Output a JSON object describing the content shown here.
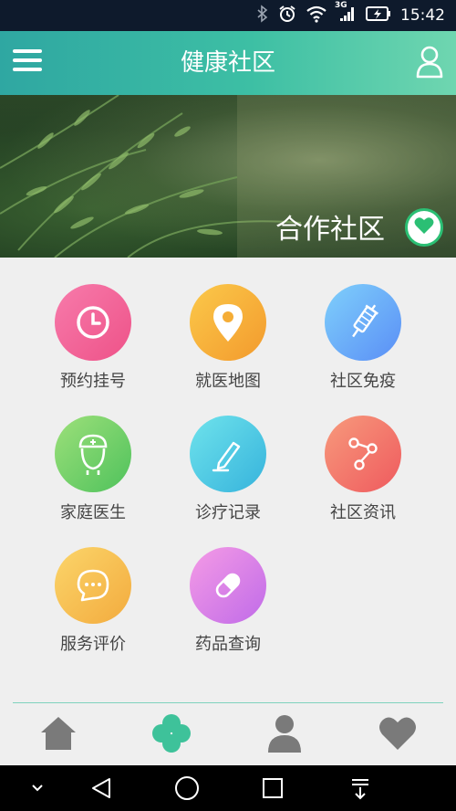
{
  "status_bar": {
    "network": "3G",
    "time": "15:42"
  },
  "header": {
    "title": "健康社区",
    "menu_icon": "menu-icon",
    "user_icon": "user-icon"
  },
  "banner": {
    "caption": "合作社区",
    "heart_icon": "heart-icon"
  },
  "services": [
    {
      "label": "预约挂号",
      "icon": "clock-icon",
      "color_from": "#f77bab",
      "color_to": "#ee5288"
    },
    {
      "label": "就医地图",
      "icon": "location-pin-icon",
      "color_from": "#fbc94a",
      "color_to": "#f39a2d"
    },
    {
      "label": "社区免疫",
      "icon": "syringe-icon",
      "color_from": "#7fd0fb",
      "color_to": "#5a8ef6"
    },
    {
      "label": "家庭医生",
      "icon": "doctor-icon",
      "color_from": "#9de07a",
      "color_to": "#4fc25c"
    },
    {
      "label": "诊疗记录",
      "icon": "pen-icon",
      "color_from": "#6fe3ec",
      "color_to": "#36b3dc"
    },
    {
      "label": "社区资讯",
      "icon": "share-nodes-icon",
      "color_from": "#f79a7c",
      "color_to": "#ef5a5e"
    },
    {
      "label": "服务评价",
      "icon": "chat-bubble-icon",
      "color_from": "#fbd56a",
      "color_to": "#f3ab3e"
    },
    {
      "label": "药品查询",
      "icon": "pill-icon",
      "color_from": "#f59be6",
      "color_to": "#c06be8"
    }
  ],
  "bottom_nav": [
    {
      "icon": "home-icon",
      "active": false
    },
    {
      "icon": "clover-icon",
      "active": true
    },
    {
      "icon": "person-icon",
      "active": false
    },
    {
      "icon": "heart-icon",
      "active": false
    }
  ],
  "colors": {
    "header_from": "#2fa7a2",
    "header_to": "#6fd6b0",
    "accent_green": "#2bbf74",
    "nav_gray": "#7a7a7a",
    "nav_active": "#3ec29a"
  }
}
